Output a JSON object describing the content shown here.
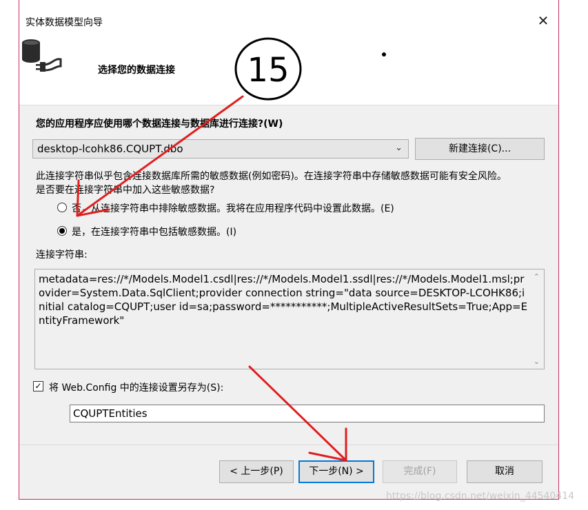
{
  "window": {
    "title": "实体数据模型向导",
    "close_glyph": "✕"
  },
  "header": {
    "title": "选择您的数据连接",
    "icon": "database-connection-icon"
  },
  "connection": {
    "question": "您的应用程序应使用哪个数据连接与数据库进行连接?(W)",
    "selected": "desktop-lcohk86.CQUPT.dbo",
    "new_button": "新建连接(C)..."
  },
  "sensitive": {
    "warning_line1": "此连接字符串似乎包含连接数据库所需的敏感数据(例如密码)。在连接字符串中存储敏感数据可能有安全风险。",
    "warning_line2": "是否要在连接字符串中加入这些敏感数据?",
    "option_no": "否，从连接字符串中排除敏感数据。我将在应用程序代码中设置此数据。(E)",
    "option_yes": "是，在连接字符串中包括敏感数据。(I)",
    "selected": "yes"
  },
  "connection_string": {
    "label": "连接字符串:",
    "value": "metadata=res://*/Models.Model1.csdl|res://*/Models.Model1.ssdl|res://*/Models.Model1.msl;provider=System.Data.SqlClient;provider connection string=\"data source=DESKTOP-LCOHK86;initial catalog=CQUPT;user id=sa;password=***********;MultipleActiveResultSets=True;App=EntityFramework\""
  },
  "save_config": {
    "checked": true,
    "label": "将 Web.Config 中的连接设置另存为(S):",
    "name": "CQUPTEntities"
  },
  "buttons": {
    "prev": "< 上一步(P)",
    "next": "下一步(N) >",
    "finish": "完成(F)",
    "cancel": "取消"
  },
  "annotation": {
    "number": "15"
  },
  "watermark": "https://blog.csdn.net/weixin_44540414",
  "colors": {
    "window_border": "#c42b64",
    "arrow": "#e01e1e",
    "focus": "#0078d7"
  }
}
